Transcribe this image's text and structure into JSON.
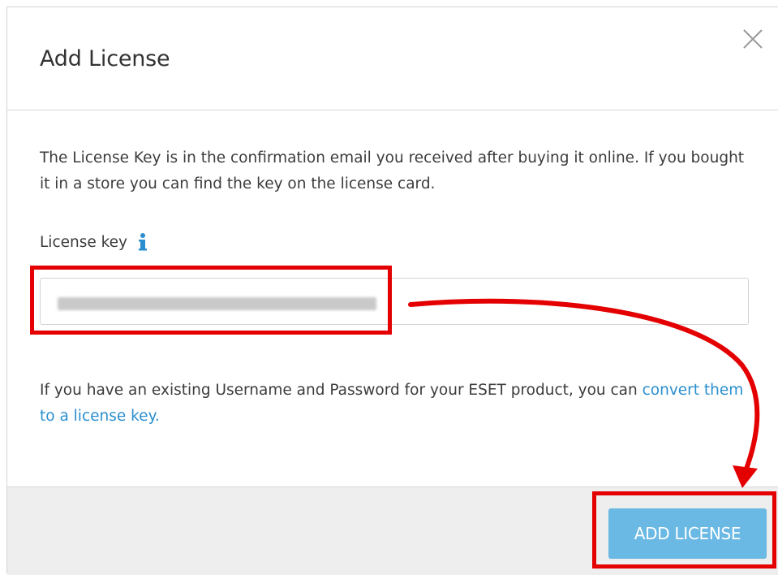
{
  "dialog": {
    "title": "Add License",
    "close_icon": "close-icon"
  },
  "body": {
    "intro_text": "The License Key is in the confirmation email you received after buying it online. If you bought it in a store you can find the key on the license card.",
    "license_key_label": "License key",
    "info_icon": "info-icon",
    "existing_text_before": "If you have an existing Username and Password for your ESET product, you can",
    "convert_link": "convert them to a license key."
  },
  "footer": {
    "add_license_label": "ADD LICENSE"
  },
  "colors": {
    "link": "#2b8fcf",
    "button_bg": "#6ab8e4",
    "annotation_red": "#e40000",
    "footer_bg": "#eeeeee"
  }
}
